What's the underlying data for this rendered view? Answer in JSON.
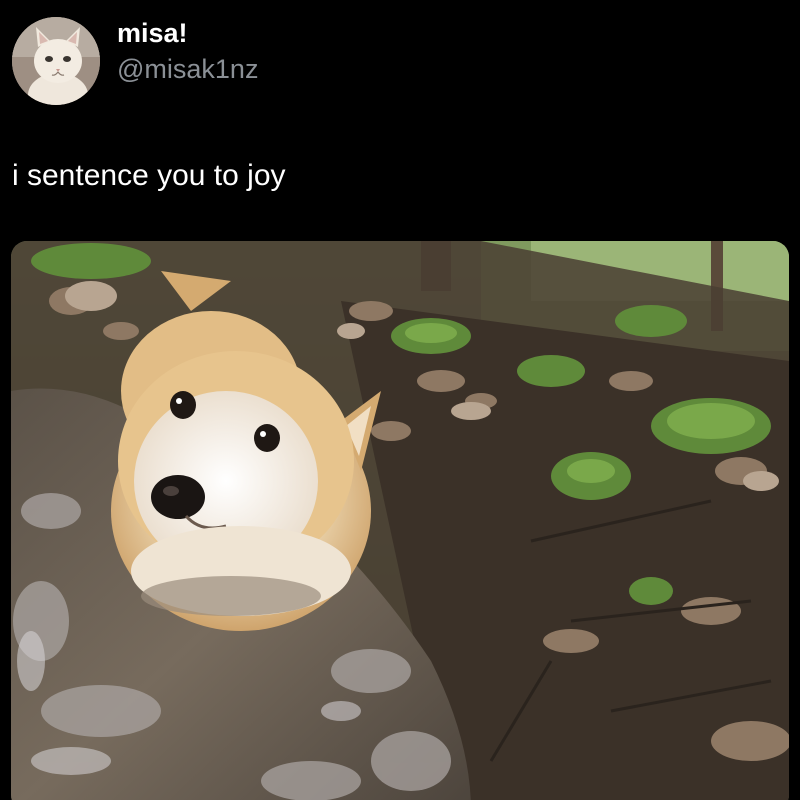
{
  "author": {
    "display_name": "misa!",
    "handle": "@misak1nz",
    "avatar_icon": "cat-avatar"
  },
  "tweet": {
    "text": "i sentence you to joy"
  },
  "media": {
    "description_icon": "corgi-in-puddle-photo"
  },
  "colors": {
    "background": "#000000",
    "text": "#ffffff",
    "secondary_text": "#8b9096"
  }
}
